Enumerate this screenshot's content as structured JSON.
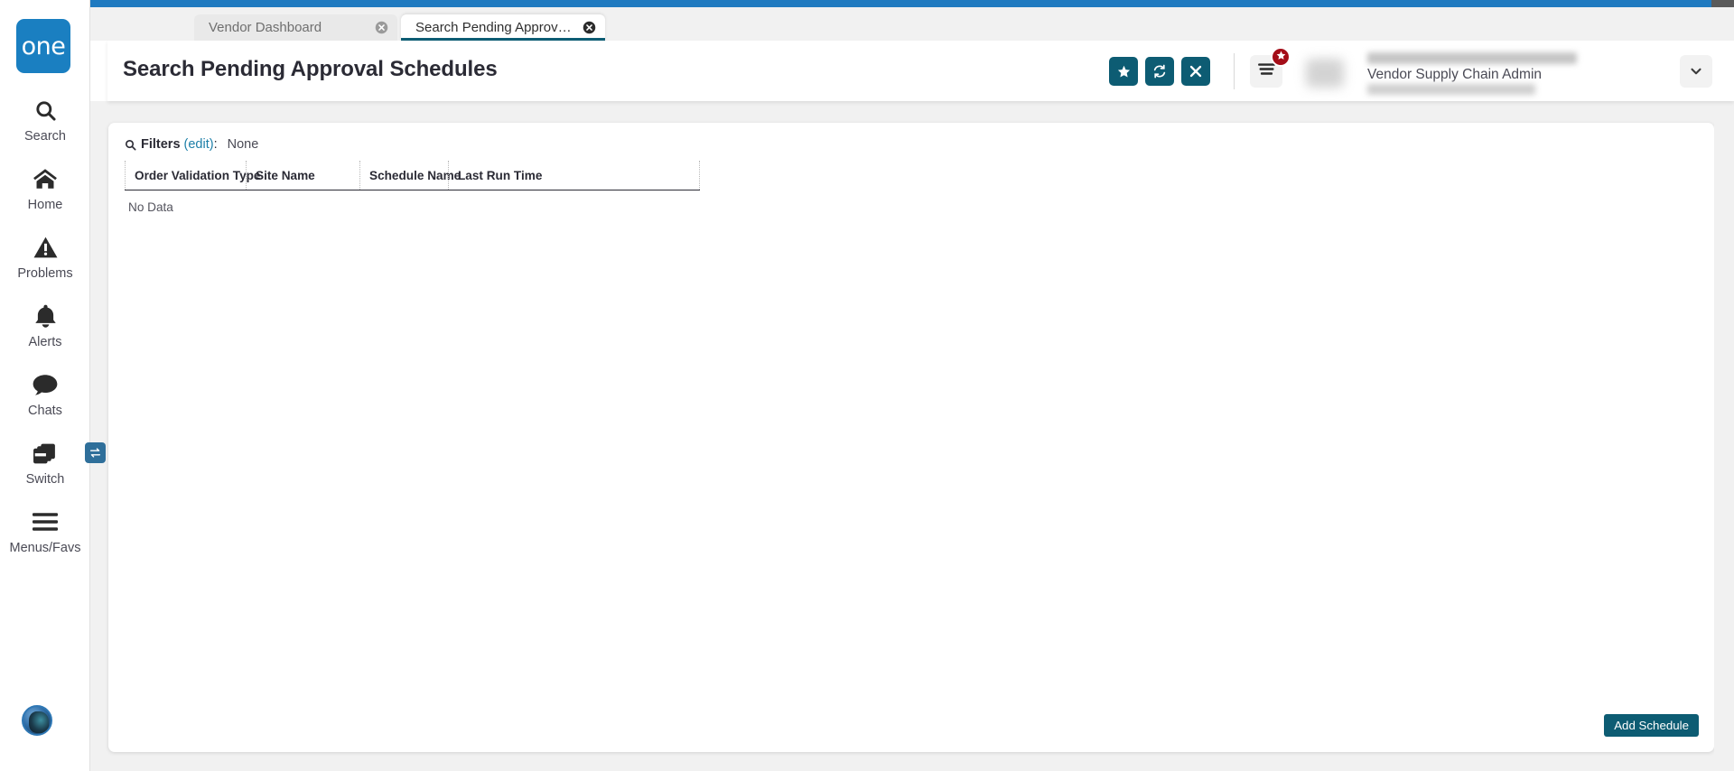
{
  "app": {
    "logo_text": "one",
    "brand_blue": "#1f7ac0",
    "accent_teal": "#0d5c73",
    "link_blue": "#1d7fa8",
    "badge_red": "#a40d18"
  },
  "sidebar": {
    "items": [
      {
        "label": "Search",
        "icon": "search-icon"
      },
      {
        "label": "Home",
        "icon": "home-icon"
      },
      {
        "label": "Problems",
        "icon": "warning-triangle-icon"
      },
      {
        "label": "Alerts",
        "icon": "bell-icon"
      },
      {
        "label": "Chats",
        "icon": "chat-bubble-icon"
      },
      {
        "label": "Switch",
        "icon": "windows-stack-icon",
        "badge_icon": "swap-arrows-icon"
      },
      {
        "label": "Menus/Favs",
        "icon": "hamburger-icon"
      }
    ],
    "avatar": "user-avatar"
  },
  "tabs": [
    {
      "label": "Vendor Dashboard",
      "active": false,
      "close_icon": "close-circle-icon"
    },
    {
      "label": "Search Pending Approval Schedu...",
      "active": true,
      "close_icon": "close-circle-icon"
    }
  ],
  "header": {
    "title": "Search Pending Approval Schedules",
    "actions": [
      {
        "name": "favorite-button",
        "icon": "star-icon"
      },
      {
        "name": "refresh-button",
        "icon": "refresh-icon"
      },
      {
        "name": "close-button",
        "icon": "x-icon"
      }
    ],
    "menu_button": {
      "icon": "hamburger-icon",
      "badge_icon": "star-icon"
    },
    "user": {
      "role": "Vendor Supply Chain Admin",
      "caret_icon": "chevron-down-icon"
    }
  },
  "filters": {
    "icon": "search-icon",
    "label": "Filters",
    "edit_label": "(edit)",
    "colon": ":",
    "value": "None"
  },
  "table": {
    "columns": [
      "Order Validation Type",
      "Site Name",
      "Schedule Name",
      "Last Run Time"
    ],
    "rows": [],
    "empty_text": "No Data"
  },
  "footer": {
    "add_label": "Add Schedule"
  }
}
